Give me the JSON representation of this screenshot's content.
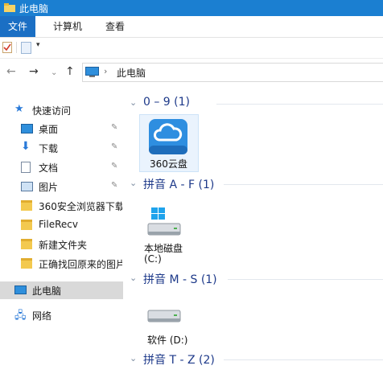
{
  "window": {
    "title": "此电脑"
  },
  "ribbon": {
    "file_tab": "文件",
    "tabs": [
      "计算机",
      "查看"
    ]
  },
  "quick_access_toolbar": {
    "icons": [
      "properties-check-icon",
      "new-page-icon",
      "customize-dropdown-icon"
    ]
  },
  "navigation": {
    "breadcrumb": [
      "此电脑"
    ],
    "buttons": [
      "back-icon",
      "forward-icon",
      "recent-dropdown-icon",
      "up-icon"
    ]
  },
  "sidebar": {
    "quick_access": {
      "label": "快速访问",
      "icon": "star-icon"
    },
    "items": [
      {
        "label": "桌面",
        "icon": "desktop-icon",
        "pinned": true
      },
      {
        "label": "下载",
        "icon": "download-icon",
        "pinned": true
      },
      {
        "label": "文档",
        "icon": "document-icon",
        "pinned": true
      },
      {
        "label": "图片",
        "icon": "picture-icon",
        "pinned": true
      },
      {
        "label": "360安全浏览器下载",
        "icon": "folder-icon",
        "pinned": false
      },
      {
        "label": "FileRecv",
        "icon": "folder-icon",
        "pinned": false
      },
      {
        "label": "新建文件夹",
        "icon": "folder-icon",
        "pinned": false
      },
      {
        "label": "正确找回原来的图片",
        "icon": "folder-icon",
        "pinned": false
      }
    ],
    "this_pc": {
      "label": "此电脑",
      "icon": "pc-icon"
    },
    "network": {
      "label": "网络",
      "icon": "network-icon"
    }
  },
  "content": {
    "groups": [
      {
        "title": "0 – 9 (1)",
        "items": [
          {
            "label": "360云盘",
            "icon": "cloud-drive-icon"
          }
        ]
      },
      {
        "title": "拼音 A - F (1)",
        "items": [
          {
            "label": "本地磁盘",
            "sublabel": "(C:)",
            "icon": "windows-drive-icon"
          }
        ]
      },
      {
        "title": "拼音 M - S (1)",
        "items": [
          {
            "label": "软件 (D:)",
            "icon": "drive-icon"
          }
        ]
      },
      {
        "title": "拼音 T - Z (2)",
        "items": []
      }
    ]
  },
  "colors": {
    "titlebar": "#1b7fd1",
    "file_tab": "#1b6fc4",
    "group_title": "#1e3a8a",
    "selection": "#d9d9d9"
  }
}
